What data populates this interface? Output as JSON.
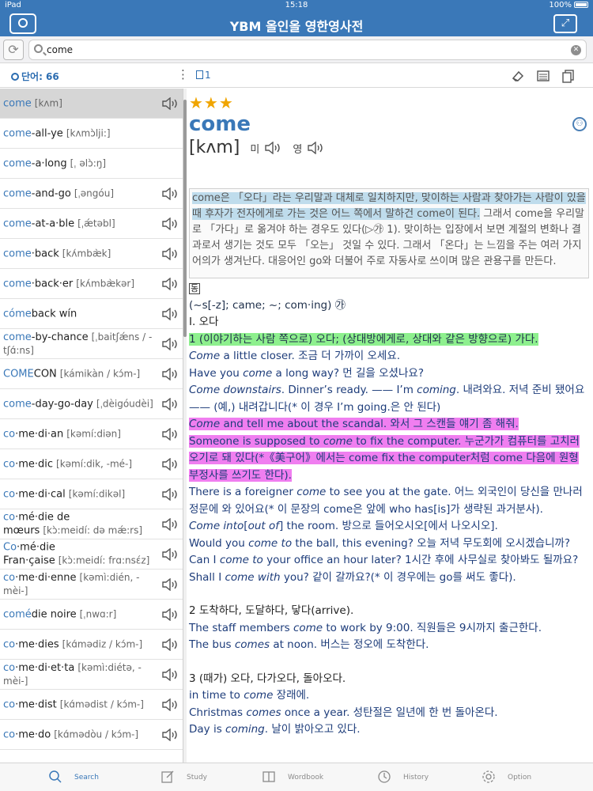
{
  "status_bar": {
    "device": "iPad",
    "time": "15:18",
    "battery": "100%"
  },
  "nav": {
    "title": "YBM 올인올 영한영사전",
    "logo_label": "YBM"
  },
  "search": {
    "query": "come",
    "placeholder": ""
  },
  "toolbar": {
    "word_count": "단어: 66",
    "note_count": "1",
    "menu_glyph": "⋮"
  },
  "word_list": [
    {
      "hl": "come",
      "rest": "",
      "pron": "[kʌm]",
      "speaker": true,
      "selected": true
    },
    {
      "hl": "come",
      "rest": "-all-ye",
      "pron": "[kʌmɔ̀lji:]",
      "speaker": false
    },
    {
      "hl": "come",
      "rest": "-a·long",
      "pron": "[ˌ əlɔ̀:ŋ]",
      "speaker": false
    },
    {
      "hl": "come",
      "rest": "-and-go",
      "pron": "[ˌəngóu]",
      "speaker": true
    },
    {
      "hl": "come",
      "rest": "-at-a·ble",
      "pron": "[ˌǽtəbl]",
      "speaker": true
    },
    {
      "hl": "come",
      "rest": "·back",
      "pron": "[kʌ́mbæ̀k]",
      "speaker": true
    },
    {
      "hl": "come",
      "rest": "·back·er",
      "pron": "[kʌ́mbæ̀kər]",
      "speaker": true
    },
    {
      "hl": "cóme",
      "rest": "back wín",
      "pron": "",
      "speaker": true
    },
    {
      "hl": "come",
      "rest": "-by-chance",
      "pron": "[ˌbaitʃǽns / -tʃɑ́:ns]",
      "speaker": true
    },
    {
      "hl": "COME",
      "rest": "CON",
      "pron": "[kámikàn / kɔ́m-]",
      "speaker": true
    },
    {
      "hl": "come",
      "rest": "-day-go-day",
      "pron": "[ˌdèigóudèi]",
      "speaker": true
    },
    {
      "hl": "co",
      "rest": "·me·di·an",
      "pron": "[kəmí:diən]",
      "speaker": true
    },
    {
      "hl": "co",
      "rest": "·me·dic",
      "pron": "[kəmí:dik, -mé-]",
      "speaker": true
    },
    {
      "hl": "co",
      "rest": "·me·di·cal",
      "pron": "[kəmí:dikəl]",
      "speaker": true
    },
    {
      "hl": "co",
      "rest": "·mé·die de mœurs",
      "pron": "[kɔ̀:meidí: də mǽ:rs]",
      "speaker": true
    },
    {
      "hl": "Co",
      "rest": "·mé·die Fran·çaise",
      "pron": "[kɔ̀:meidí: frɑ:nsέz]",
      "speaker": true
    },
    {
      "hl": "co",
      "rest": "·me·di·enne",
      "pron": "[kəmì:dién, -mèi-]",
      "speaker": true
    },
    {
      "hl": "comé",
      "rest": "die noire",
      "pron": "[ˌnwɑ:r]",
      "speaker": true
    },
    {
      "hl": "co",
      "rest": "·me·dies",
      "pron": "[kɑ́mədiz / kɔ́m-]",
      "speaker": true
    },
    {
      "hl": "co",
      "rest": "·me·di·et·ta",
      "pron": "[kəmì:diétə, -mèi-]",
      "speaker": true
    },
    {
      "hl": "co",
      "rest": "·me·dist",
      "pron": "[kɑ́mədist / kɔ́m-]",
      "speaker": true
    },
    {
      "hl": "co",
      "rest": "·me·do",
      "pron": "[kɑ́mədòu / kɔ́m-]",
      "speaker": true
    }
  ],
  "entry": {
    "stars": "★★★",
    "headword": "come",
    "pronunciation": "[kʌm]",
    "us_label": "미",
    "uk_label": "영",
    "note_hl": "come은 「오다」라는 우리말과 대체로 일치하지만, 맞이하는 사람과 찾아가는 사람이 있을 때 후자가 전자에게로 가는 것은 어느 쪽에서 말하건 come이 된다.",
    "note_rest": " 그래서 come을 우리말로 「가다」로 옮겨야 하는 경우도 있다(▷㉮ 1). 맞이하는 입장에서 보면 계절의 변화나 결과로서 생기는 것도 모두 「오는」 것일 수 있다. 그래서 「온다」는 느낌을 주는 여러 가지 어의가 생겨난다. 대응어인 go와 더불어 주로 자동사로 쓰이며 많은 관용구를 만든다.",
    "pos": "동",
    "forms": "(~s[-z]; came; ~; com·ing) ㉮",
    "section": "Ⅰ. 오다",
    "sense1": "1 (이야기하는 사람 쪽으로) 오다; (상대방에게로, 상대와 같은 방향으로) 가다.",
    "ex1_a": "Come",
    "ex1_b": " a little closer. 조금 더 가까이 오세요.",
    "ex2_a": "Have you ",
    "ex2_i": "come",
    "ex2_b": " a long way? 먼 길을 오셨나요?",
    "ex3_i1": "Come downstairs",
    "ex3_b": ". Dinner’s ready. —— I’m ",
    "ex3_i2": "coming",
    "ex3_c": ". 내려와요. 저녁 준비 됐어요 —— (예,) 내려갑니다(* 이 경우 I’m going.은 안 된다)",
    "ex4_i": "Come",
    "ex4_b": " and tell me about the scandal. 와서 그 스캔들 얘기 좀 해줘.",
    "ex5_a": "Someone is supposed to ",
    "ex5_i": "come",
    "ex5_b": " to fix the computer. 누군가가 컴퓨터를 고치러 오기로 돼 있다(*《美구어》에서는 come fix the computer처럼 come 다음에 원형 부정사를 쓰기도 한다).",
    "ex6_a": "There is a foreigner ",
    "ex6_i": "come",
    "ex6_b": " to see you at the gate. 어느 외국인이 당신을 만나러 정문에 와 있어요(* 이 문장의 come은 앞에 who has[is]가 생략된 과거분사).",
    "ex7_i": "Come into",
    "ex7_b": "[",
    "ex7_i2": "out of",
    "ex7_c": "] the room. 방으로 들어오시오[에서 나오시오].",
    "ex8_a": "Would you ",
    "ex8_i": "come to",
    "ex8_b": " the ball, this evening? 오늘 저녁 무도회에 오시겠습니까?",
    "ex9_a": "Can I ",
    "ex9_i": "come to",
    "ex9_b": " your office an hour later? 1시간 후에 사무실로 찾아봐도 될까요?",
    "ex10_a": "Shall I ",
    "ex10_i": "come with",
    "ex10_b": " you? 같이 갈까요?(* 이 경우에는 go를 써도 좋다).",
    "sense2": "2 도착하다, 도달하다, 닿다(arrive).",
    "ex11_a": "The staff members ",
    "ex11_i": "come",
    "ex11_b": " to work by 9:00. 직원들은 9시까지 출근한다.",
    "ex12_a": "The bus ",
    "ex12_i": "comes",
    "ex12_b": " at noon. 버스는 정오에 도착한다.",
    "sense3": "3 (때가) 오다, 다가오다, 돌아오다.",
    "ex13_a": "in time to ",
    "ex13_i": "come",
    "ex13_b": " 장래에.",
    "ex14_a": "Christmas ",
    "ex14_i": "comes",
    "ex14_b": " once a year. 성탄절은 일년에 한 번 돌아온다.",
    "ex15_a": "Day is ",
    "ex15_i": "coming",
    "ex15_b": ". 날이 밝아오고 있다."
  },
  "tabs": [
    {
      "label": "Search",
      "icon": "search-icon",
      "active": true
    },
    {
      "label": "Study",
      "icon": "study-icon",
      "active": false
    },
    {
      "label": "Wordbook",
      "icon": "wordbook-icon",
      "active": false
    },
    {
      "label": "History",
      "icon": "history-icon",
      "active": false
    },
    {
      "label": "Option",
      "icon": "gear-icon",
      "active": false
    }
  ],
  "colors": {
    "brand": "#3a78b8",
    "star": "#f0a500",
    "hl_green": "#8ef08e",
    "hl_pink": "#f07ef0",
    "hl_blue": "#bfdcec"
  }
}
